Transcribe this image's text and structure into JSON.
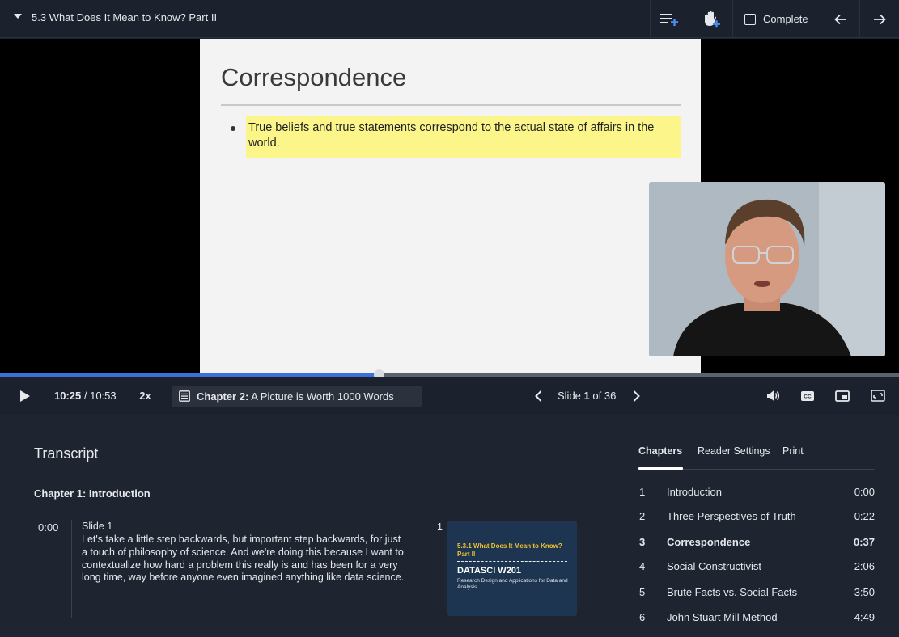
{
  "header": {
    "title": "5.3 What Does It Mean to Know? Part II",
    "complete_label": "Complete"
  },
  "slide": {
    "title": "Correspondence",
    "bullet": "True beliefs and true statements correspond to the actual state of affairs in the world."
  },
  "player": {
    "progress_fraction": 0.421,
    "current_time": "10:25",
    "time_separator": " / ",
    "duration": "10:53",
    "speed": "2x",
    "chapter_prefix": "Chapter 2:",
    "chapter_title": "A Picture is Worth 1000 Words",
    "slide_word": "Slide",
    "slide_current": "1",
    "slide_of": "of",
    "slide_total": "36"
  },
  "transcript": {
    "heading": "Transcript",
    "chapter_heading": "Chapter 1: Introduction",
    "entry": {
      "time": "0:00",
      "slide_label": "Slide 1",
      "text": "Let's take a little step backwards, but important step backwards, for just a touch of philosophy of science. And we're doing this because I want to contextualize how hard a problem this really is and has been for a very long time, way before anyone even imagined anything like data science.",
      "thumb_number": "1",
      "thumb_title": "5.3.1 What Does It Mean to Know? Part II",
      "thumb_course": "DATASCI W201",
      "thumb_subtitle": "Research Design and Applications for Data and Analysis"
    }
  },
  "sidebar": {
    "tabs": [
      "Chapters",
      "Reader Settings",
      "Print"
    ],
    "active_tab": "Chapters",
    "chapters": [
      {
        "num": "1",
        "title": "Introduction",
        "time": "0:00"
      },
      {
        "num": "2",
        "title": "Three Perspectives of Truth",
        "time": "0:22"
      },
      {
        "num": "3",
        "title": "Correspondence",
        "time": "0:37"
      },
      {
        "num": "4",
        "title": "Social Constructivist",
        "time": "2:06"
      },
      {
        "num": "5",
        "title": "Brute Facts vs. Social Facts",
        "time": "3:50"
      },
      {
        "num": "6",
        "title": "John Stuart Mill Method",
        "time": "4:49"
      }
    ],
    "current_chapter": "3"
  },
  "colors": {
    "progress": "#3d6fd8",
    "highlight": "#fbf58a",
    "background": "#1e2430"
  },
  "icons": {
    "menu_caret": "caret-down-icon",
    "add_playlist": "playlist-add-icon",
    "raise_hand": "raise-hand-icon",
    "prev": "arrow-left-icon",
    "next": "arrow-right-icon",
    "play": "play-icon",
    "volume": "volume-icon",
    "captions": "cc-icon",
    "pip": "picture-in-picture-icon",
    "fullscreen": "fullscreen-icon"
  }
}
